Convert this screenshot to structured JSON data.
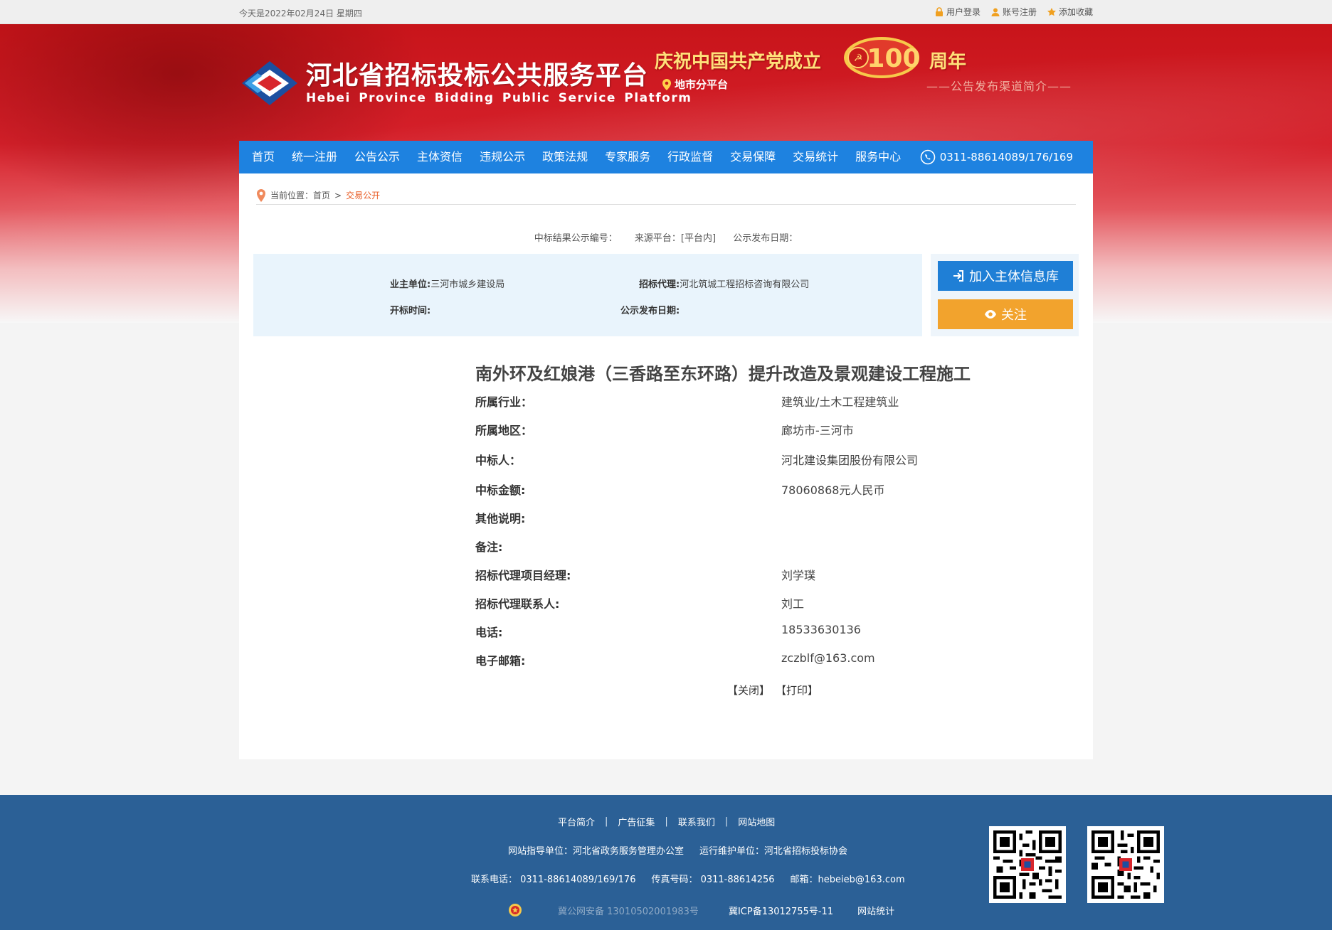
{
  "topbar": {
    "date": "今天是2022年02月24日 星期四",
    "login": "用户登录",
    "register": "账号注册",
    "favorite": "添加收藏"
  },
  "logo": {
    "title": "河北省招标投标公共服务平台",
    "subtitle": "Hebei Province Bidding Public Service Platform"
  },
  "celebration": {
    "line1": "庆祝中国共产党成立",
    "number": "100",
    "suffix": "周年",
    "subline": "——公告发布渠道简介——"
  },
  "city_platform": "地市分平台",
  "nav": {
    "items": [
      "首页",
      "统一注册",
      "公告公示",
      "主体资信",
      "违规公示",
      "政策法规",
      "专家服务",
      "行政监督",
      "交易保障",
      "交易统计",
      "服务中心"
    ],
    "phone": "0311-88614089/176/169"
  },
  "breadcrumb": {
    "prefix": "当前位置：",
    "home": "首页",
    "sep": ">",
    "current": "交易公开"
  },
  "meta": {
    "notice_no": "中标结果公示编号：",
    "source": "来源平台：[平台内]",
    "publish_date": "公示发布日期："
  },
  "info": {
    "owner_label": "业主单位:",
    "owner_value": "三河市城乡建设局",
    "agent_label": "招标代理:",
    "agent_value": "河北筑城工程招标咨询有限公司",
    "open_time_label": "开标时间:",
    "publish_label": "公示发布日期:"
  },
  "actions": {
    "join": "加入主体信息库",
    "follow": "关注"
  },
  "project": {
    "title": "南外环及红娘港（三香路至东环路）提升改造及景观建设工程施工",
    "rows": [
      {
        "k": "所属行业：",
        "v": "建筑业/土木工程建筑业"
      },
      {
        "k": "所属地区：",
        "v": "廊坊市-三河市"
      },
      {
        "k": "中标人：",
        "v": "河北建设集团股份有限公司"
      },
      {
        "k": "中标金额:",
        "v": "78060868元人民币"
      },
      {
        "k": "其他说明:",
        "v": ""
      },
      {
        "k": "备注:",
        "v": ""
      },
      {
        "k": "招标代理项目经理:",
        "v": "刘学璞"
      },
      {
        "k": "招标代理联系人:",
        "v": "刘工"
      },
      {
        "k": "电话:",
        "v": "18533630136"
      },
      {
        "k": "电子邮箱:",
        "v": "zczblf@163.com"
      }
    ]
  },
  "ops": {
    "close": "【关闭】",
    "print": "【打印】"
  },
  "footer": {
    "links": [
      "平台简介",
      "广告征集",
      "联系我们",
      "网站地图"
    ],
    "sep": "|",
    "guide": "网站指导单位：河北省政务服务管理办公室",
    "maint": "运行维护单位：河北省招标投标协会",
    "tel": "联系电话： 0311-88614089/169/176",
    "fax": "传真号码： 0311-88614256",
    "mail": "邮箱：hebeieb@163.com",
    "police": "冀公网安备 13010502001983号",
    "icp": "冀ICP备13012755号-11",
    "stats": "网站统计"
  },
  "colors": {
    "nav": "#1e82e0",
    "accent_orange": "#e85a22",
    "button_blue": "#1f7fd6",
    "button_orange": "#f2a32d",
    "footer": "#2b6096"
  }
}
